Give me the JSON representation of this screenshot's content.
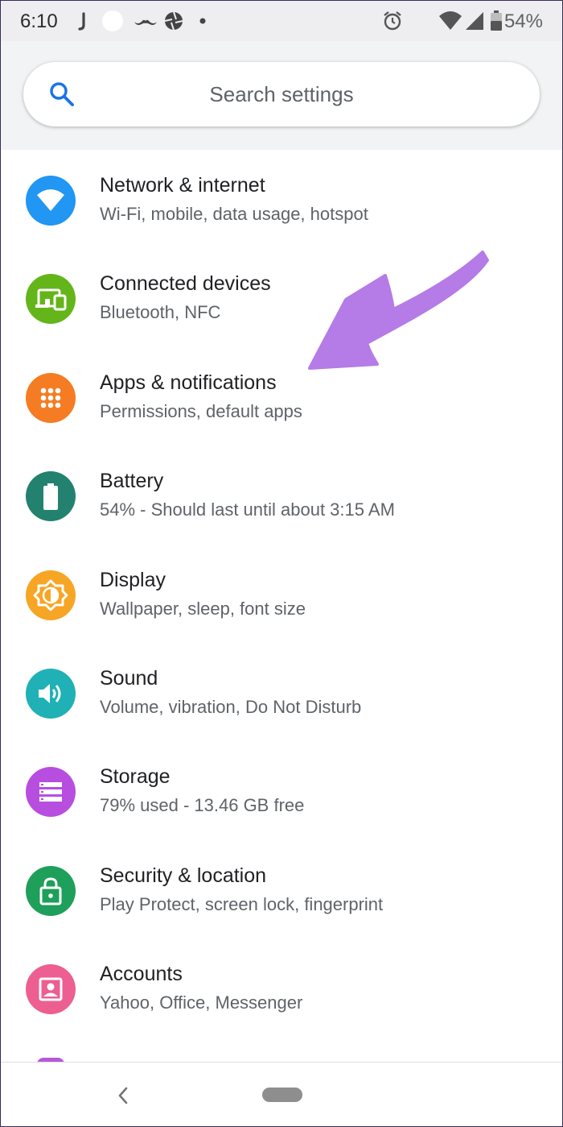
{
  "status_bar": {
    "time": "6:10",
    "battery_percent": "54%",
    "left_icons": [
      "j-notification-icon",
      "circle-notification-icon",
      "mustache-notification-icon",
      "aperture-notification-icon",
      "dot-more-icon"
    ],
    "right_icons": [
      "alarm-icon",
      "wifi-icon",
      "cell-signal-icon",
      "battery-icon"
    ]
  },
  "search": {
    "placeholder": "Search settings",
    "icon": "search-icon",
    "icon_color": "#1a73e8"
  },
  "settings": {
    "items": [
      {
        "title": "Network & internet",
        "subtitle": "Wi-Fi, mobile, data usage, hotspot",
        "icon": "wifi-icon",
        "color": "#2196f3"
      },
      {
        "title": "Connected devices",
        "subtitle": "Bluetooth, NFC",
        "icon": "devices-icon",
        "color": "#64b51a"
      },
      {
        "title": "Apps & notifications",
        "subtitle": "Permissions, default apps",
        "icon": "apps-grid-icon",
        "color": "#f57c22"
      },
      {
        "title": "Battery",
        "subtitle": "54% - Should last until about 3:15 AM",
        "icon": "battery-icon",
        "color": "#22826f"
      },
      {
        "title": "Display",
        "subtitle": "Wallpaper, sleep, font size",
        "icon": "brightness-icon",
        "color": "#f7a525"
      },
      {
        "title": "Sound",
        "subtitle": "Volume, vibration, Do Not Disturb",
        "icon": "volume-icon",
        "color": "#1fb1b5"
      },
      {
        "title": "Storage",
        "subtitle": "79% used - 13.46 GB free",
        "icon": "storage-icon",
        "color": "#b74ee0"
      },
      {
        "title": "Security & location",
        "subtitle": "Play Protect, screen lock, fingerprint",
        "icon": "lock-icon",
        "color": "#1e9f5a"
      },
      {
        "title": "Accounts",
        "subtitle": "Yahoo, Office, Messenger",
        "icon": "account-box-icon",
        "color": "#ec5f90"
      }
    ]
  },
  "annotation": {
    "icon": "purple-arrow-annotation",
    "color": "#b57be6",
    "points_to": "Apps & notifications"
  },
  "nav_bar": {
    "back_icon": "chevron-left-icon",
    "home_icon": "home-pill-icon"
  }
}
